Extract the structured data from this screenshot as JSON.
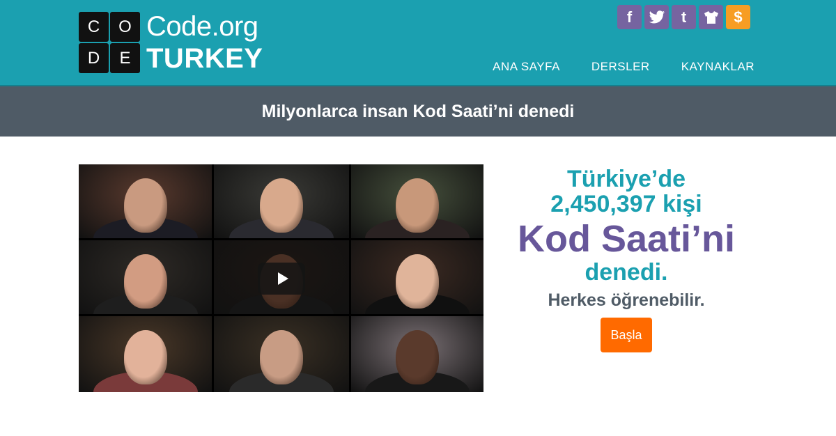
{
  "header": {
    "logo": {
      "letters": [
        "C",
        "O",
        "D",
        "E"
      ],
      "line1": "Code.org",
      "line2": "TURKEY"
    },
    "social": [
      {
        "name": "facebook-icon",
        "glyph": "f"
      },
      {
        "name": "twitter-icon",
        "glyph": "🐦"
      },
      {
        "name": "tumblr-icon",
        "glyph": "t"
      },
      {
        "name": "shirt-icon",
        "glyph": "👕"
      },
      {
        "name": "donate-icon",
        "glyph": "$"
      }
    ],
    "nav": [
      "ANA SAYFA",
      "DERSLER",
      "KAYNAKLAR"
    ]
  },
  "banner": {
    "title": "Milyonlarca insan Kod Saati’ni denedi"
  },
  "video": {
    "play_icon": "play-icon",
    "tiles": [
      {
        "bg": "#5a3a2e",
        "skin": "#c99a80",
        "shirt": "#1c1c24"
      },
      {
        "bg": "#3a3a36",
        "skin": "#d8a98c",
        "shirt": "#2a2a30"
      },
      {
        "bg": "#46503c",
        "skin": "#c8987a",
        "shirt": "#2a2222"
      },
      {
        "bg": "#2e2a26",
        "skin": "#d29c82",
        "shirt": "#1e1e1e"
      },
      {
        "bg": "#1c1612",
        "skin": "#4a3024",
        "shirt": "#151515"
      },
      {
        "bg": "#3c2a22",
        "skin": "#e0b49a",
        "shirt": "#101010"
      },
      {
        "bg": "#4a3828",
        "skin": "#e2b29a",
        "shirt": "#7a3a3a"
      },
      {
        "bg": "#3a3024",
        "skin": "#c89c84",
        "shirt": "#2a2a2a"
      },
      {
        "bg": "#7a7074",
        "skin": "#5a3a2c",
        "shirt": "#181818"
      }
    ]
  },
  "stats": {
    "line1": "Türkiye’de",
    "line2": "2,450,397 kişi",
    "line3": "Kod Saati’ni",
    "line4": "denedi.",
    "line5": "Herkes öğrenebilir.",
    "button": "Başla"
  },
  "colors": {
    "teal": "#1ba0b0",
    "purple": "#67579a",
    "orange": "#ff6a00",
    "banner": "#4f5b66"
  }
}
